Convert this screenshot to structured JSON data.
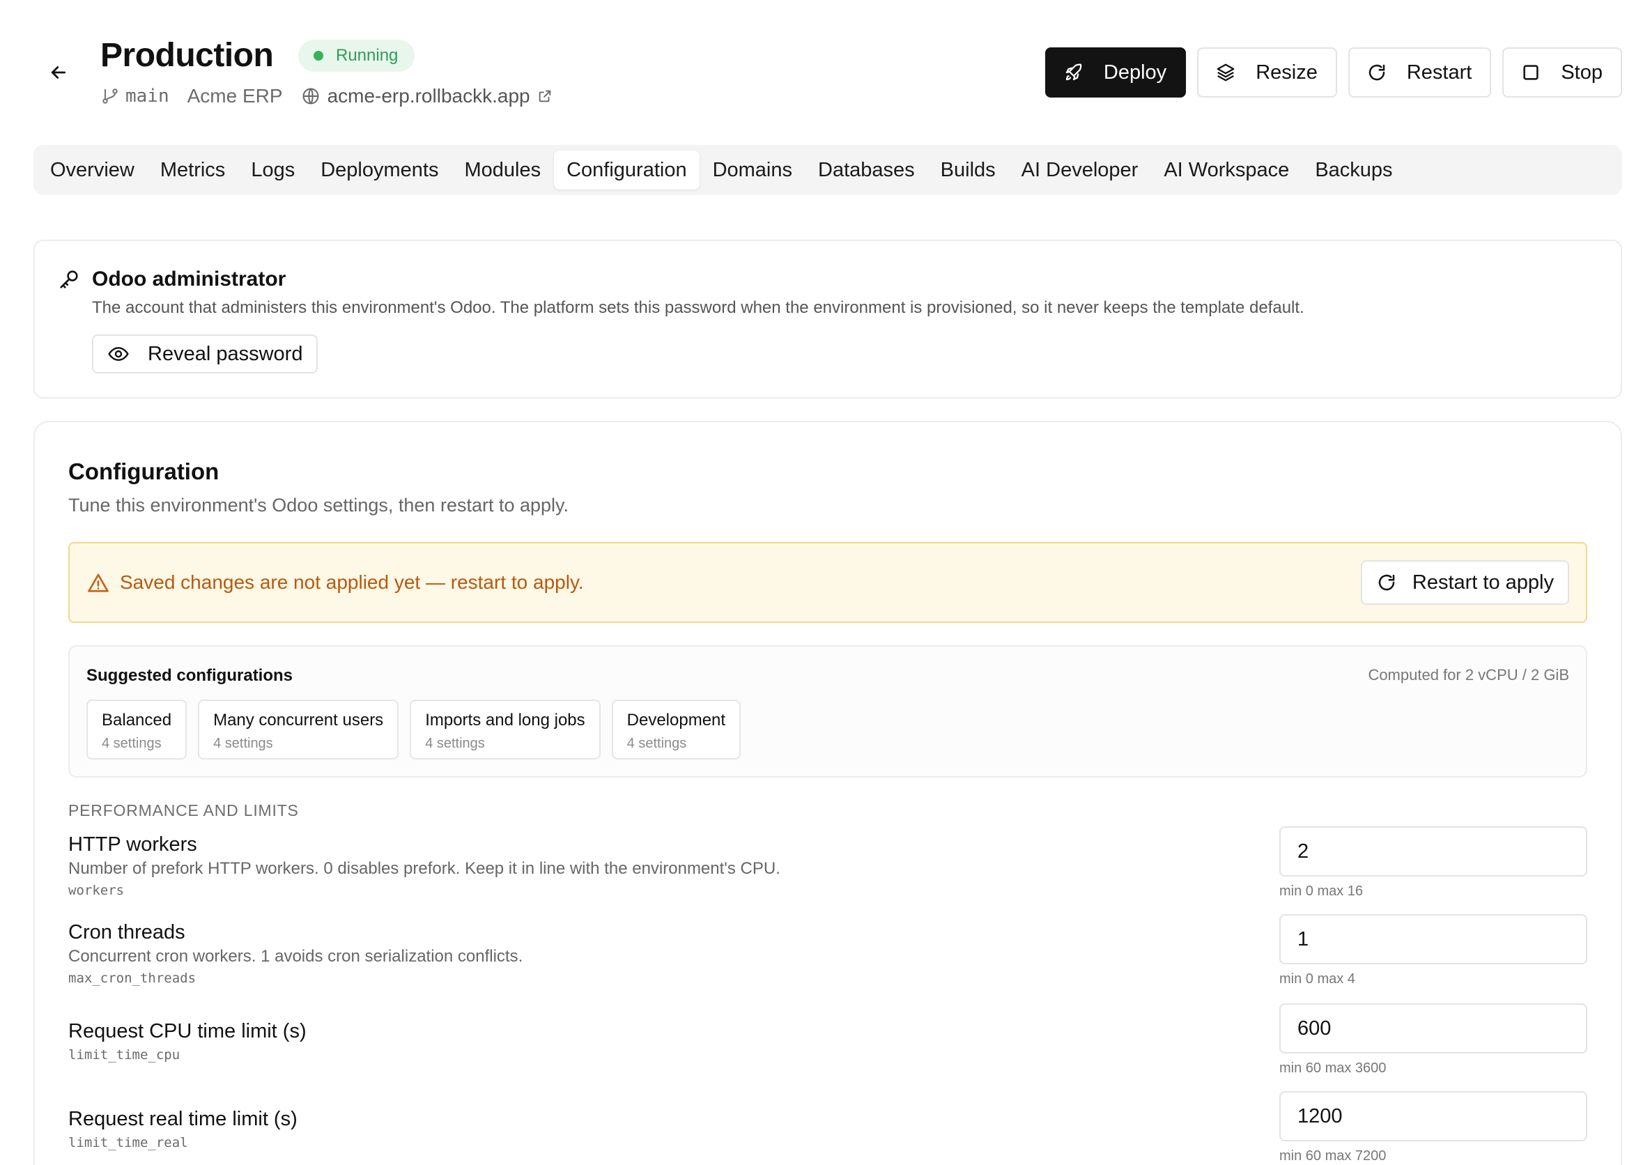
{
  "header": {
    "title": "Production",
    "status": "Running",
    "branch": "main",
    "project": "Acme ERP",
    "url": "acme-erp.rollbackk.app",
    "colors": {
      "status_bg": "#e8f6ec",
      "status_fg": "#2f9e55",
      "primary": "#131313"
    }
  },
  "actions": {
    "deploy": "Deploy",
    "resize": "Resize",
    "restart": "Restart",
    "stop": "Stop"
  },
  "tabs": [
    {
      "label": "Overview"
    },
    {
      "label": "Metrics"
    },
    {
      "label": "Logs"
    },
    {
      "label": "Deployments"
    },
    {
      "label": "Modules"
    },
    {
      "label": "Configuration",
      "active": true
    },
    {
      "label": "Domains"
    },
    {
      "label": "Databases"
    },
    {
      "label": "Builds"
    },
    {
      "label": "AI Developer"
    },
    {
      "label": "AI Workspace"
    },
    {
      "label": "Backups"
    }
  ],
  "admin": {
    "title": "Odoo administrator",
    "description": "The account that administers this environment's Odoo. The platform sets this password when the environment is provisioned, so it never keeps the template default.",
    "reveal_label": "Reveal password"
  },
  "config": {
    "title": "Configuration",
    "subtitle": "Tune this environment's Odoo settings, then restart to apply.",
    "warning": {
      "text": "Saved changes are not applied yet — restart to apply.",
      "button": "Restart to apply",
      "colors": {
        "bg": "#fef8e6",
        "border": "#f3d98a",
        "text": "#b65a10"
      }
    },
    "suggested": {
      "title": "Suggested configurations",
      "computed": "Computed for 2 vCPU / 2 GiB",
      "presets": [
        {
          "label": "Balanced",
          "count": "4 settings"
        },
        {
          "label": "Many concurrent users",
          "count": "4 settings"
        },
        {
          "label": "Imports and long jobs",
          "count": "4 settings"
        },
        {
          "label": "Development",
          "count": "4 settings"
        }
      ]
    },
    "section": "PERFORMANCE AND LIMITS",
    "fields": [
      {
        "label": "HTTP workers",
        "description": "Number of prefork HTTP workers. 0 disables prefork. Keep it in line with the environment's CPU.",
        "key": "workers",
        "value": "2",
        "hint": "min 0 max 16"
      },
      {
        "label": "Cron threads",
        "description": "Concurrent cron workers. 1 avoids cron serialization conflicts.",
        "key": "max_cron_threads",
        "value": "1",
        "hint": "min 0 max 4"
      },
      {
        "label": "Request CPU time limit (s)",
        "description": "",
        "key": "limit_time_cpu",
        "value": "600",
        "hint": "min 60 max 3600"
      },
      {
        "label": "Request real time limit (s)",
        "description": "",
        "key": "limit_time_real",
        "value": "1200",
        "hint": "min 60 max 7200"
      }
    ]
  }
}
